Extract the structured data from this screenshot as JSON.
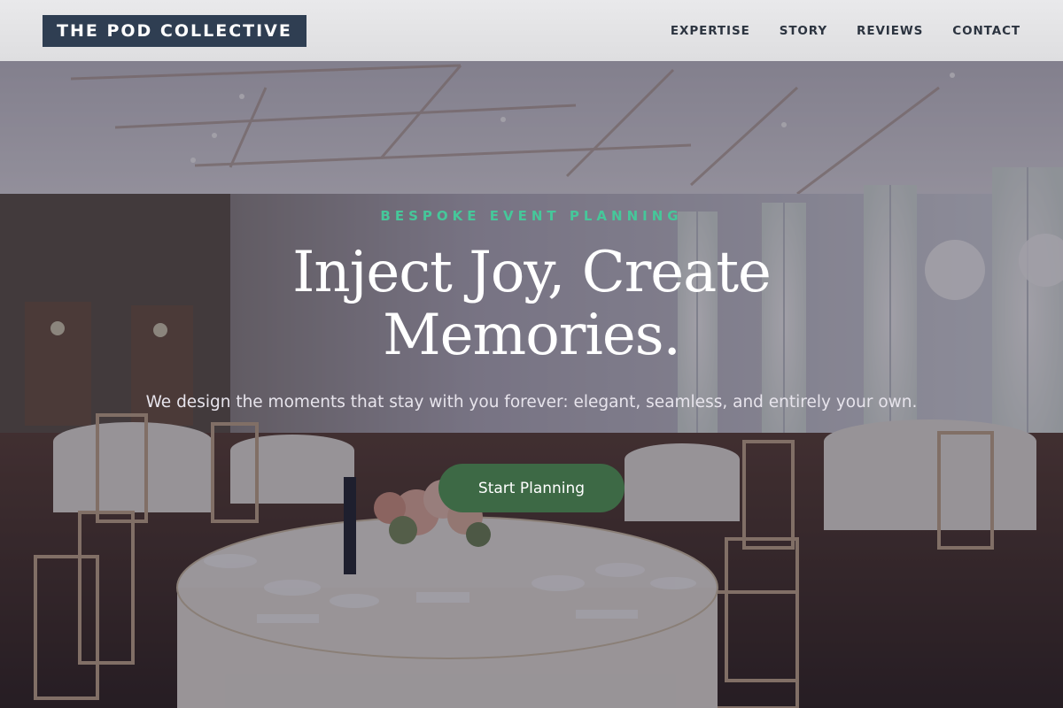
{
  "brand": {
    "name": "THE POD COLLECTIVE"
  },
  "nav": {
    "items": [
      {
        "label": "EXPERTISE"
      },
      {
        "label": "STORY"
      },
      {
        "label": "REVIEWS"
      },
      {
        "label": "CONTACT"
      }
    ]
  },
  "hero": {
    "eyebrow": "BESPOKE EVENT PLANNING",
    "headline": "Inject Joy, Create Memories.",
    "subline": "We design the moments that stay with you forever: elegant, seamless, and entirely your own.",
    "cta_label": "Start Planning",
    "background_image": "banquet-hall-with-set-tables"
  },
  "colors": {
    "logo_bg": "#2f3e52",
    "eyebrow": "#46c79a",
    "cta_bg": "#3d6945",
    "header_bg": "#e9e9eb"
  }
}
